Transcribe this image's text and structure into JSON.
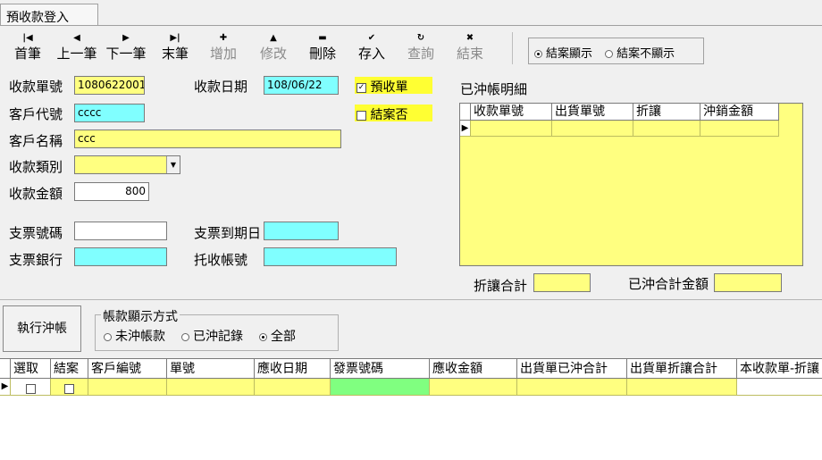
{
  "tab": {
    "title": "預收款登入"
  },
  "toolbar": {
    "first": "首筆",
    "prev": "上一筆",
    "next": "下一筆",
    "last": "末筆",
    "add": "增加",
    "edit": "修改",
    "delete": "刪除",
    "save": "存入",
    "query": "查詢",
    "finish": "結束"
  },
  "view_filter": {
    "opt1": "結案顯示",
    "opt2": "結案不顯示",
    "selected": "結案顯示"
  },
  "form": {
    "receipt_no_label": "收款單號",
    "receipt_no": "1080622001",
    "receipt_date_label": "收款日期",
    "receipt_date": "108/06/22",
    "prepaid_label": "預收單",
    "closed_label": "結案否",
    "customer_code_label": "客戶代號",
    "customer_code": "cccc",
    "customer_name_label": "客戶名稱",
    "customer_name": "ccc",
    "category_label": "收款類別",
    "category": "",
    "amount_label": "收款金額",
    "amount": "800",
    "cheque_no_label": "支票號碼",
    "cheque_no": "",
    "cheque_due_label": "支票到期日",
    "cheque_due": "",
    "cheque_bank_label": "支票銀行",
    "cheque_bank": "",
    "collect_acct_label": "托收帳號",
    "collect_acct": ""
  },
  "offset_detail": {
    "title": "已沖帳明細",
    "columns": [
      "收款單號",
      "出貨單號",
      "折讓",
      "沖銷金額"
    ],
    "discount_total_label": "折讓合計",
    "discount_total": "",
    "offset_total_label": "已沖合計金額",
    "offset_total": ""
  },
  "actions": {
    "run_offset": "執行沖帳",
    "display_mode_title": "帳款顯示方式",
    "mode_opt1": "未沖帳款",
    "mode_opt2": "已沖記錄",
    "mode_opt3": "全部"
  },
  "bottom_grid": {
    "columns": [
      "選取",
      "結案",
      "客戶編號",
      "單號",
      "應收日期",
      "發票號碼",
      "應收金額",
      "出貨單已沖合計",
      "出貨單折讓合計",
      "本收款單-折讓"
    ]
  },
  "colors": {
    "yellow": "#ffff80",
    "cyan": "#80ffff",
    "green": "#80ff80",
    "highlight": "#ffff33"
  }
}
